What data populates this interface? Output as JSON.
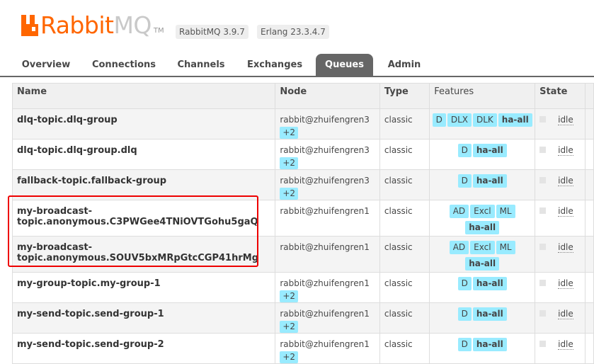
{
  "header": {
    "logo_rabbit": "Rabbit",
    "logo_mq": "MQ",
    "logo_tm": "TM",
    "rabbitmq_version": "RabbitMQ 3.9.7",
    "erlang_version": "Erlang 23.3.4.7"
  },
  "tabs": [
    {
      "label": "Overview"
    },
    {
      "label": "Connections"
    },
    {
      "label": "Channels"
    },
    {
      "label": "Exchanges"
    },
    {
      "label": "Queues",
      "active": true
    },
    {
      "label": "Admin"
    }
  ],
  "table": {
    "headers": {
      "name": "Name",
      "node": "Node",
      "type": "Type",
      "features": "Features",
      "state": "State"
    },
    "rows": [
      {
        "name": "dlq-topic.dlq-group",
        "node": "rabbit@zhuifengren3",
        "node_extra": "+2",
        "type": "classic",
        "features": [
          "D",
          "DLX",
          "DLK"
        ],
        "policy": "ha-all",
        "state": "idle"
      },
      {
        "name": "dlq-topic.dlq-group.dlq",
        "node": "rabbit@zhuifengren3",
        "node_extra": "+2",
        "type": "classic",
        "features": [
          "D"
        ],
        "policy": "ha-all",
        "state": "idle"
      },
      {
        "name": "fallback-topic.fallback-group",
        "node": "rabbit@zhuifengren3",
        "node_extra": "+2",
        "type": "classic",
        "features": [
          "D"
        ],
        "policy": "ha-all",
        "state": "idle"
      },
      {
        "name_line1": "my-broadcast-",
        "name_line2": "topic.anonymous.C3PWGee4TNiOVTGohu5gaQ",
        "node": "rabbit@zhuifengren1",
        "node_extra": "",
        "type": "classic",
        "features": [
          "AD",
          "Excl",
          "ML"
        ],
        "policy": "ha-all",
        "state": "idle"
      },
      {
        "name_line1": "my-broadcast-",
        "name_line2": "topic.anonymous.SOUV5bxMRpGtcCGP41hrMg",
        "node": "rabbit@zhuifengren1",
        "node_extra": "",
        "type": "classic",
        "features": [
          "AD",
          "Excl",
          "ML"
        ],
        "policy": "ha-all",
        "state": "idle"
      },
      {
        "name": "my-group-topic.my-group-1",
        "node": "rabbit@zhuifengren1",
        "node_extra": "+2",
        "type": "classic",
        "features": [
          "D"
        ],
        "policy": "ha-all",
        "state": "idle"
      },
      {
        "name": "my-send-topic.send-group-1",
        "node": "rabbit@zhuifengren1",
        "node_extra": "+2",
        "type": "classic",
        "features": [
          "D"
        ],
        "policy": "ha-all",
        "state": "idle"
      },
      {
        "name": "my-send-topic.send-group-2",
        "node": "rabbit@zhuifengren1",
        "node_extra": "+2",
        "type": "classic",
        "features": [
          "D"
        ],
        "policy": "ha-all",
        "state": "idle"
      }
    ]
  },
  "colors": {
    "brand": "#ff6600",
    "tab_active": "#666666",
    "badge": "#99ebff",
    "highlight_box": "#ee0000"
  }
}
